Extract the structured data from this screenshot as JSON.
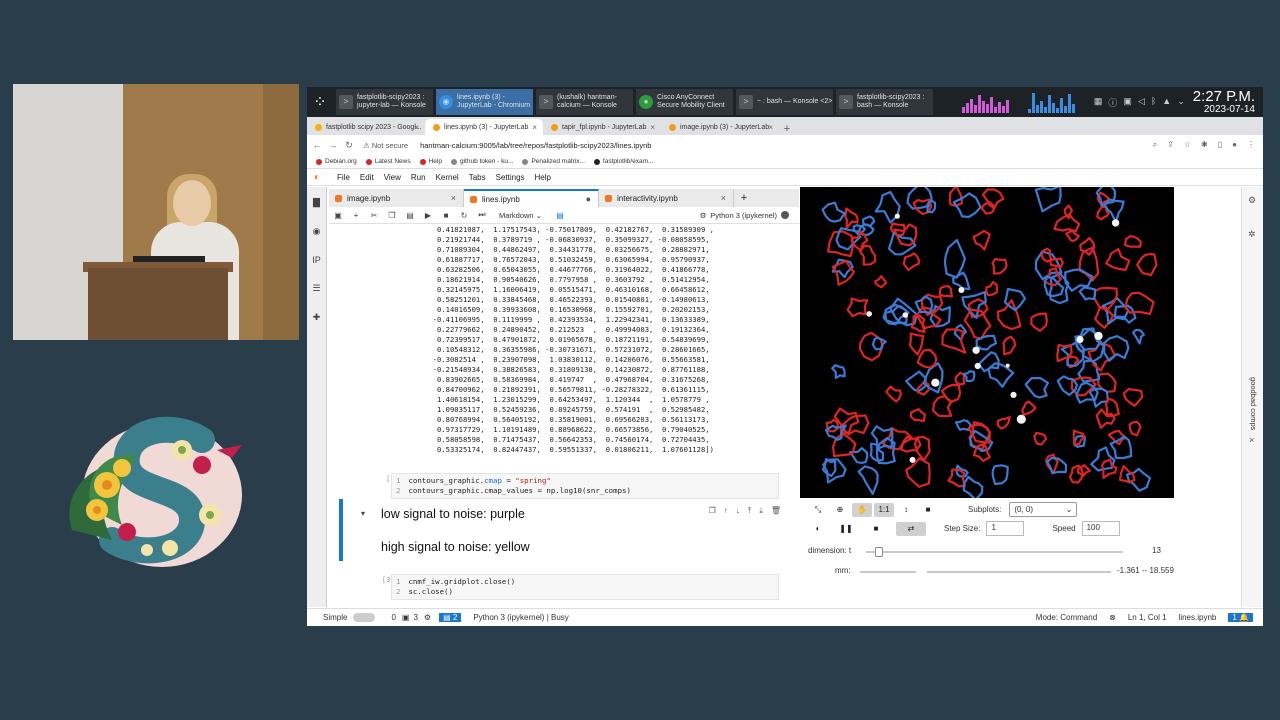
{
  "taskbar": {
    "tasks": [
      {
        "line1": "fastplotlib-scipy2023 :",
        "line2": "jupyter-lab — Konsole",
        "icon": "terminal-icon"
      },
      {
        "line1": "lines.ipynb (3) -",
        "line2": "JupyterLab - Chromium",
        "icon": "chromium-icon",
        "active": true
      },
      {
        "line1": "(kushalk) hantman-",
        "line2": "calcium — Konsole",
        "icon": "terminal-icon"
      },
      {
        "line1": "Cisco AnyConnect",
        "line2": "Secure Mobility Client",
        "icon": "cisco-icon"
      },
      {
        "line1": "~ : bash — Konsole <2>",
        "line2": "",
        "icon": "terminal-icon"
      },
      {
        "line1": "fastplotlib-scipy2023 :",
        "line2": "bash — Konsole",
        "icon": "terminal-icon"
      }
    ],
    "time": "2:27 P.M.",
    "date": "2023-07-14"
  },
  "browser": {
    "tabs": [
      {
        "label": "fastplotlib scipy 2023 - Googl..."
      },
      {
        "label": "lines.ipynb (3) - JupyterLab",
        "active": true
      },
      {
        "label": "tapir_fpl.ipynb - JupyterLab"
      },
      {
        "label": "image.ipynb (3) - JupyterLab"
      }
    ],
    "security": "Not secure",
    "url": "hantman-calcium:9005/lab/tree/repos/fastplotlib-scipy2023/lines.ipynb",
    "bookmarks": [
      "Debian.org",
      "Latest News",
      "Help",
      "github token - ku...",
      "Penalized matrix...",
      "fastplotlib/exam..."
    ]
  },
  "jupyter": {
    "menu": [
      "File",
      "Edit",
      "View",
      "Run",
      "Kernel",
      "Tabs",
      "Settings",
      "Help"
    ],
    "notebook_tabs": [
      {
        "label": "image.ipynb"
      },
      {
        "label": "lines.ipynb",
        "active": true
      },
      {
        "label": "interactivity.ipynb"
      }
    ],
    "cell_type": "Markdown",
    "kernel": "Python 3 (ipykernel)",
    "output_lines": [
      "   0.41821087,  1.17517543, -0.75017809,  0.42182767,  0.31589309 ,",
      "   0.21921744,  0.3789719 , -0.06830937,  0.35099327, -0.08058595,",
      "   0.71089304,  0.44862497,  0.34431778,  0.03256675,  0.28882971,",
      "   0.61887717,  0.76572043,  0.51032459,  0.63065994,  0.95790937,",
      "   0.63282506,  0.65043055,  0.44677766,  0.31964022,  0.41866778,",
      "   0.18621914,  0.90540626,  0.7797958 ,  0.3603792 ,  0.51412954,",
      "   0.32145975,  1.16006419,  0.05515471,  0.46310168,  0.66458612,",
      "   0.58251201,  0.33845468,  0.46522393,  0.01540801, -0.14980613,",
      "   0.14016509,  0.39933608,  0.16530968,  0.15592701,  0.20202153,",
      "  -0.41106995,  0.1119999 ,  0.42393534,  1.22942341,  0.13633389,",
      "   0.22779662,  0.24890452,  0.212523  ,  0.49994003,  0.19132364,",
      "   0.72399517,  0.47901872,  0.01965678,  0.18721191,  0.54839699,",
      "   0.10548312,  0.36355986, -0.30731671,  0.57231072,  0.28601665,",
      "  -0.3082514 ,  0.23907098,  1.03830112,  0.14206076,  0.55663581,",
      "  -0.21548934,  0.38826583,  0.31809138,  0.14230872,  0.87761188,",
      "   0.83902665,  0.58369984,  0.419747  ,  0.47968704,  0.31675268,",
      "   0.84700962,  0.21892391,  0.56579811, -0.28278322,  0.61361115,",
      "   1.40618154,  1.23015299,  0.64253497,  1.120344  ,  1.0578779 ,",
      "   1.09035117,  0.52459236,  0.89245759,  0.574191  ,  0.52985482,",
      "   0.80768994,  0.56405192,  0.35819001,  0.69566203,  0.56113173,",
      "   0.97317729,  1.10191489,  0.88968622,  0.66573856,  0.79040525,",
      "   0.58058598,  0.71475437,  0.56642353,  0.74560174,  0.72704435,",
      "   0.53325174,  0.82447437,  0.59551337,  0.01806211,  1.07601128])"
    ],
    "cell1": {
      "prompt": "[*]:",
      "line1": {
        "n": "1",
        "pre": "contours_graphic.",
        "attr": "cmap",
        "op": " = ",
        "str": "\"spring\""
      },
      "line2": {
        "n": "2",
        "text": "contours_graphic.cmap_values = np.log10(snr_comps)"
      }
    },
    "markdown": {
      "line1": "low signal to noise: purple",
      "line2": "high signal to noise: yellow"
    },
    "cell2": {
      "prompt": "[30]:",
      "line1": {
        "n": "1",
        "text": "cnmf_iw.gridplot.close()"
      },
      "line2": {
        "n": "2",
        "text": "sc.close()"
      }
    }
  },
  "plot_controls": {
    "zoom_label": "1:1",
    "subplots_label": "Subplots:",
    "subplots_value": "(0, 0)",
    "step_label": "Step Size:",
    "step_value": "1",
    "speed_label": "Speed",
    "speed_value": "100",
    "dimension_label": "dimension: t",
    "dimension_value": "13",
    "dimension_fraction": 0.05,
    "mm_label": "mm:",
    "mm_value": "-1.361 -- 18.559"
  },
  "right_sidebar": {
    "panel_title": "goodbad comps"
  },
  "statusbar": {
    "mode_label": "Simple",
    "count_a": "0",
    "count_b": "3",
    "kernel_count": "2",
    "kernel_status": "Python 3 (ipykernel) | Busy",
    "mode": "Mode: Command",
    "position": "Ln 1, Col 1",
    "filename": "lines.ipynb",
    "badge": "1"
  },
  "colors": {
    "background": "#2a3d4a",
    "accent": "#1976d2",
    "contour_red": "#e02424",
    "contour_blue": "#3a7bd5"
  }
}
